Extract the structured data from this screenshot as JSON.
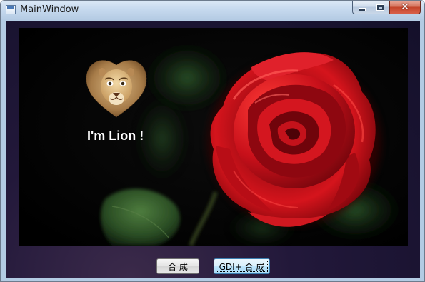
{
  "window": {
    "title": "MainWindow",
    "icons": {
      "app": "window-app-icon",
      "minimize": "minimize-icon",
      "maximize": "maximize-icon",
      "close": "close-icon"
    },
    "close_glyph": "✕"
  },
  "canvas": {
    "overlay_text": "I'm Lion !",
    "images": [
      "lion-heart-image",
      "red-rose-image"
    ]
  },
  "buttons": {
    "compose_label": "合 成",
    "gdi_compose_label": "GDI+ 合 成"
  },
  "colors": {
    "client_background": "#1b1533",
    "rose_red": "#c8101a",
    "leaf_green": "#2f5a2a"
  }
}
